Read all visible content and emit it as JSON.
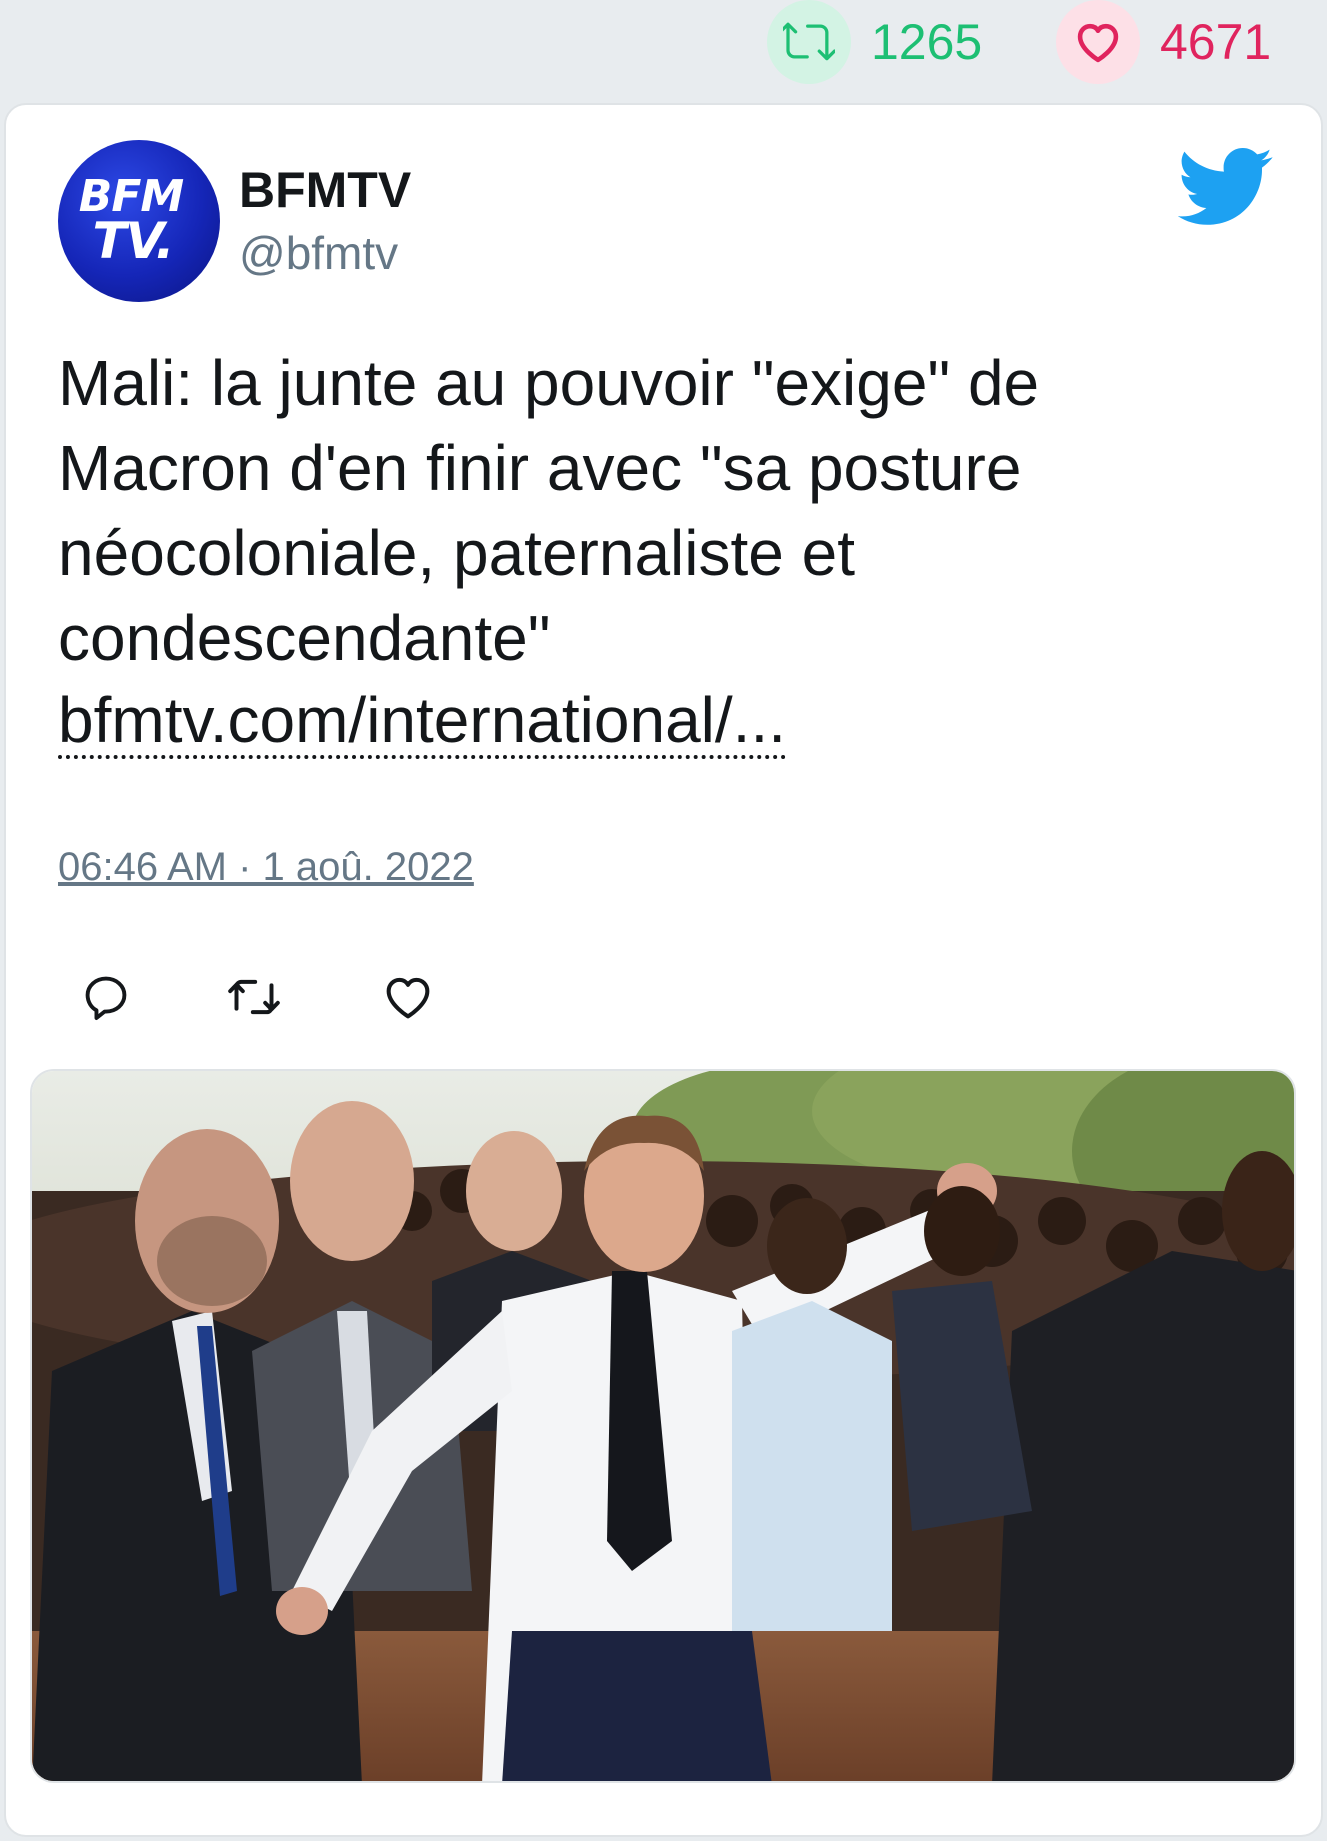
{
  "stats": {
    "retweets": "1265",
    "likes": "4671"
  },
  "tweet": {
    "author_name": "BFMTV",
    "author_handle": "@bfmtv",
    "avatar_text_line1": "BFM",
    "avatar_text_line2": "TV.",
    "text_lines": [
      "Mali: la junte au pouvoir \"exige\" de",
      "Macron d'en finir avec \"sa posture",
      "néocoloniale, paternaliste et",
      "condescendante\""
    ],
    "link": "bfmtv.com/international/...",
    "timestamp": "06:46 AM · 1 aoû. 2022"
  },
  "colors": {
    "retweet": "#1dbf73",
    "like": "#e0245e",
    "twitter_blue": "#1da1f2",
    "text": "#14171a",
    "muted": "#657786"
  },
  "icons": {
    "stat_retweet": "retweet-icon",
    "stat_like": "heart-icon",
    "brand": "twitter-bird-icon",
    "reply": "reply-icon",
    "retweet": "retweet-icon",
    "like": "heart-icon"
  }
}
